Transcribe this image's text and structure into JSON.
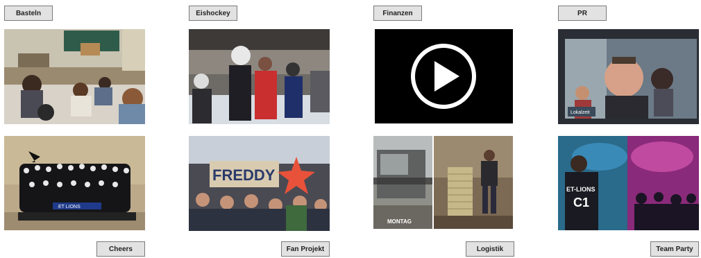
{
  "categories": {
    "basteln": "Basteln",
    "eishockey": "Eishockey",
    "finanzen": "Finanzen",
    "pr": "PR",
    "cheers": "Cheers",
    "fan_projekt": "Fan Projekt",
    "logistik": "Logistik",
    "team_party": "Team Party"
  },
  "image_text": {
    "freddy_sign": "FREDDY",
    "lokalzeit": "Lokalzeit",
    "montag": "MONTAG",
    "et_lions_shirt": "ET-LIONS",
    "c1_shirt": "C1",
    "lions_banner": "ET LIONS"
  },
  "icons": {
    "play": "play-icon"
  }
}
